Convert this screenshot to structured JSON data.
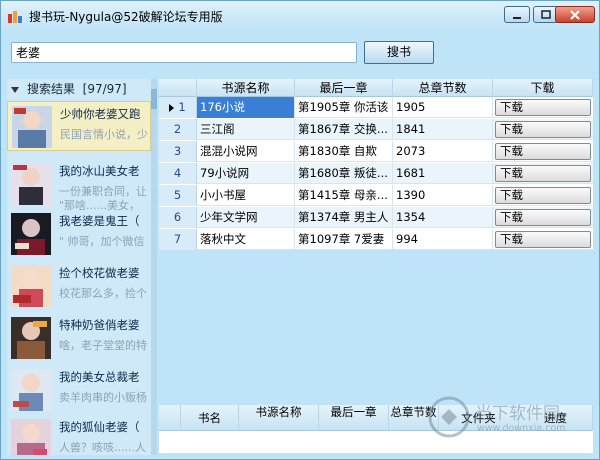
{
  "window": {
    "title": "搜书玩-Nygula@52破解论坛专用版",
    "minimize_icon": "minimize-icon",
    "maximize_icon": "maximize-icon",
    "close_icon": "close-icon"
  },
  "search": {
    "value": "老婆",
    "button_label": "搜书"
  },
  "results_panel": {
    "header": "搜索结果",
    "count": "[97/97]",
    "books": [
      {
        "title": "少帅你老婆又跑",
        "desc": "民国言情小说，少",
        "selected": true
      },
      {
        "title": "我的冰山美女老",
        "desc": "一份兼职合同，让",
        "desc2": "\"那啥......美女，"
      },
      {
        "title": "我老婆是鬼王（",
        "desc": "\" 帅哥，加个微信"
      },
      {
        "title": "捡个校花做老婆",
        "desc": "校花那么多，捡个"
      },
      {
        "title": "特种奶爸俏老婆",
        "desc": "啥，老子堂堂的特"
      },
      {
        "title": "我的美女总裁老",
        "desc": "卖羊肉串的小贩杨"
      },
      {
        "title": "我的狐仙老婆（",
        "desc": "人兽？咳咳......人"
      }
    ]
  },
  "source_table": {
    "columns": [
      "书源名称",
      "最后一章",
      "总章节数",
      "下载"
    ],
    "rows": [
      {
        "idx": "1",
        "source": "176小说",
        "last": "第1905章 你活该",
        "total": "1905",
        "download": "下载"
      },
      {
        "idx": "2",
        "source": "三江阁",
        "last": "第1867章 交换...",
        "total": "1841",
        "download": "下载"
      },
      {
        "idx": "3",
        "source": "混混小说网",
        "last": "第1830章 自欺",
        "total": "2073",
        "download": "下载"
      },
      {
        "idx": "4",
        "source": "79小说网",
        "last": "第1680章 叛徒...",
        "total": "1681",
        "download": "下载"
      },
      {
        "idx": "5",
        "source": "小小书屋",
        "last": "第1415章 母亲...",
        "total": "1390",
        "download": "下载"
      },
      {
        "idx": "6",
        "source": "少年文学网",
        "last": "第1374章 男主人",
        "total": "1354",
        "download": "下载"
      },
      {
        "idx": "7",
        "source": "落秋中文",
        "last": "第1097章 7爱妻",
        "total": "994",
        "download": "下载"
      }
    ]
  },
  "download_table": {
    "columns": [
      "书名",
      "书源名称",
      "最后一章",
      "总章节数",
      "文件夹",
      "进度"
    ]
  },
  "watermark": {
    "text": "当下软件园",
    "url": "www.downxia.com"
  }
}
